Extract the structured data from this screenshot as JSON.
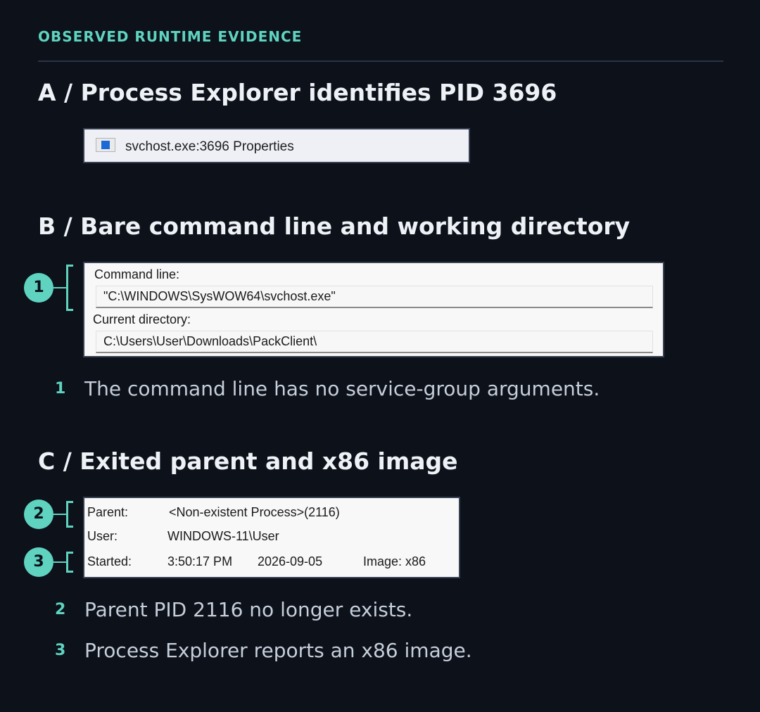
{
  "eyebrow": "OBSERVED RUNTIME EVIDENCE",
  "sections": {
    "a": {
      "heading": "A / Process Explorer identifies PID 3696",
      "window_title": "svchost.exe:3696 Properties",
      "icon": "window-app-icon"
    },
    "b": {
      "heading": "B / Bare command line and working directory",
      "command_line_label": "Command line:",
      "command_line_value": "\"C:\\WINDOWS\\SysWOW64\\svchost.exe\"",
      "current_directory_label": "Current directory:",
      "current_directory_value": "C:\\Users\\User\\Downloads\\PackClient\\"
    },
    "c": {
      "heading": "C / Exited parent and x86 image",
      "parent_label": "Parent:",
      "parent_value": "<Non-existent Process>(2116)",
      "user_label": "User:",
      "user_value": "WINDOWS-11\\User",
      "started_label": "Started:",
      "started_time": "3:50:17 PM",
      "started_date": "2026-09-05",
      "image_text": "Image: x86"
    }
  },
  "markers": [
    "1",
    "2",
    "3"
  ],
  "notes": [
    {
      "num": "1",
      "text": "The command line has no service-group arguments."
    },
    {
      "num": "2",
      "text": "Parent PID 2116 no longer exists."
    },
    {
      "num": "3",
      "text": "Process Explorer reports an x86 image."
    }
  ],
  "colors": {
    "background": "#0c111a",
    "accent": "#5fd3c0",
    "heading": "#eef1f6",
    "body_text": "#c6ced9"
  }
}
